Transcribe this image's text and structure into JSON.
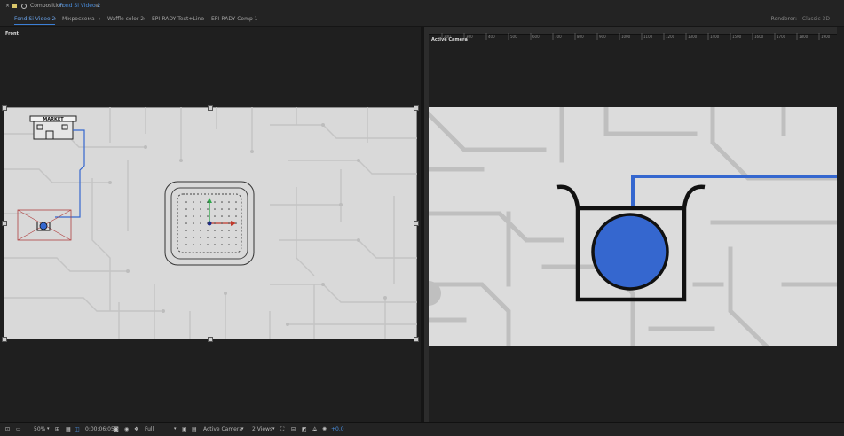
{
  "titlebar": {
    "close_glyph": "×",
    "label": "Composition",
    "comp_name": "Fond Si Video 2"
  },
  "tabs": [
    {
      "label": "Fond Si Video 2",
      "active": true
    },
    {
      "label": "Мікросхема",
      "active": false
    },
    {
      "label": "Waffle color 2",
      "active": false
    },
    {
      "label": "EPI-RADY Text+Line",
      "active": false
    },
    {
      "label": "EPI-RADY Comp 1",
      "active": false
    }
  ],
  "renderer": {
    "label": "Renderer:",
    "value": "Classic 3D"
  },
  "left_view": {
    "label": "Front",
    "sign_text": "MARKET"
  },
  "right_view": {
    "label": "Active Camera",
    "ruler_ticks": [
      "200",
      "300",
      "400",
      "500",
      "600",
      "700",
      "800",
      "900",
      "1000",
      "1100",
      "1200",
      "1300",
      "1400",
      "1500",
      "1600",
      "1700",
      "1800",
      "1900",
      "2000",
      "2100"
    ]
  },
  "bottombar": {
    "zoom": "50%",
    "timecode": "0:00:06:05",
    "resolution": "Full",
    "camera": "Active Camera",
    "views": "2 Views",
    "exposure": "+0.0"
  },
  "colors": {
    "accent": "#3b7fd6",
    "circuit_bg": "#d8d8d8",
    "circuit_line": "#c2c2c2",
    "blue_fill": "#3567cf",
    "icon_stroke": "#111111"
  }
}
